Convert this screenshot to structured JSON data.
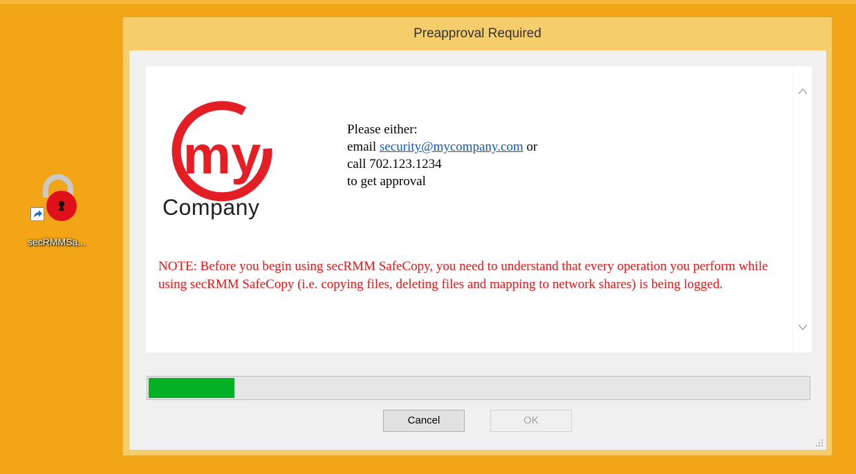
{
  "desktop": {
    "icon_label": "secRMMSa..."
  },
  "dialog": {
    "title": "Preapproval Required",
    "logo": {
      "mark_text": "my",
      "word": "Company",
      "accent": "#e31e24"
    },
    "info": {
      "line1": "Please either:",
      "email_prefix": "email ",
      "email": "security@mycompany.com",
      "email_suffix": " or",
      "line3": "call 702.123.1234",
      "line4": "to get approval"
    },
    "note": "NOTE:  Before you begin using secRMM SafeCopy, you need to understand that every operation you perform while using secRMM SafeCopy (i.e. copying files, deleting files and mapping to network shares) is being logged.",
    "progress": {
      "fraction": 0.13,
      "color": "#06b025"
    },
    "buttons": {
      "cancel": "Cancel",
      "ok": "OK"
    }
  },
  "colors": {
    "desktop": "#f2a516",
    "window_frame": "#f6cd6b",
    "note_text": "#ee1111",
    "link": "#0b57d0"
  }
}
